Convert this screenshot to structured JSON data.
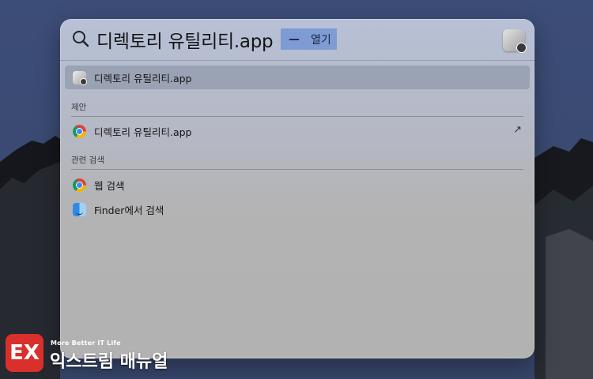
{
  "search": {
    "query": "디렉토리 유틸리티.app",
    "open_dash": "—",
    "open_label": "열기"
  },
  "top_hit": {
    "label": "디렉토리 유틸리티.app",
    "icon": "directory-utility-icon"
  },
  "suggestions": {
    "title": "제안",
    "items": [
      {
        "label": "디렉토리 유틸리티.app",
        "icon": "chrome-icon",
        "action_icon": "↗"
      }
    ]
  },
  "related": {
    "title": "관련 검색",
    "items": [
      {
        "label": "웹 검색",
        "icon": "chrome-icon"
      },
      {
        "label": "Finder에서 검색",
        "icon": "finder-icon"
      }
    ]
  },
  "watermark": {
    "logo_text": "EX",
    "subtitle": "More Better IT Life",
    "title": "익스트림 매뉴얼"
  },
  "colors": {
    "accent_highlight": "#7e9bd4",
    "brand_red": "#d9302c",
    "wallpaper": "#3a4a72"
  }
}
